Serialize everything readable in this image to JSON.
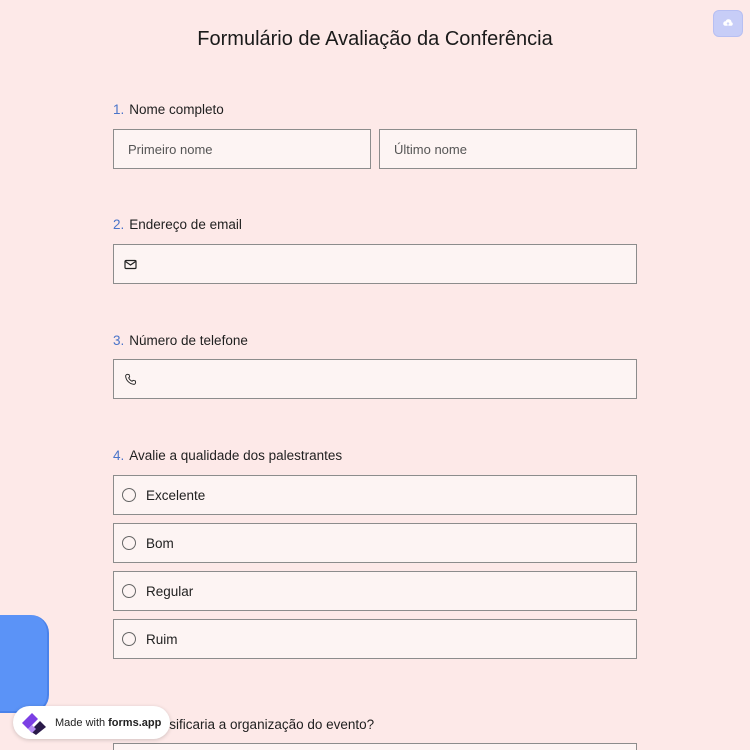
{
  "form": {
    "title": "Formulário de Avaliação da Conferência"
  },
  "toolbar": {
    "save_icon": "cloud-upload-icon",
    "accent_color": "#c7cdf7"
  },
  "questions": {
    "q1": {
      "number": "1.",
      "label": "Nome completo",
      "first_placeholder": "Primeiro nome",
      "last_placeholder": "Último nome"
    },
    "q2": {
      "number": "2.",
      "label": "Endereço de email",
      "icon": "envelope-icon"
    },
    "q3": {
      "number": "3.",
      "label": "Número de telefone",
      "icon": "phone-icon"
    },
    "q4": {
      "number": "4.",
      "label": "Avalie a qualidade dos palestrantes",
      "options": [
        "Excelente",
        "Bom",
        "Regular",
        "Ruim"
      ]
    },
    "q5": {
      "label_visible": "você classificaria a organização do evento?"
    }
  },
  "badge": {
    "prefix": "Made with",
    "brand": "forms.app"
  },
  "colors": {
    "background": "#fde9e8",
    "field_bg": "#fdf4f3",
    "number_accent": "#4a74c9",
    "blob": "#5b93f7"
  }
}
